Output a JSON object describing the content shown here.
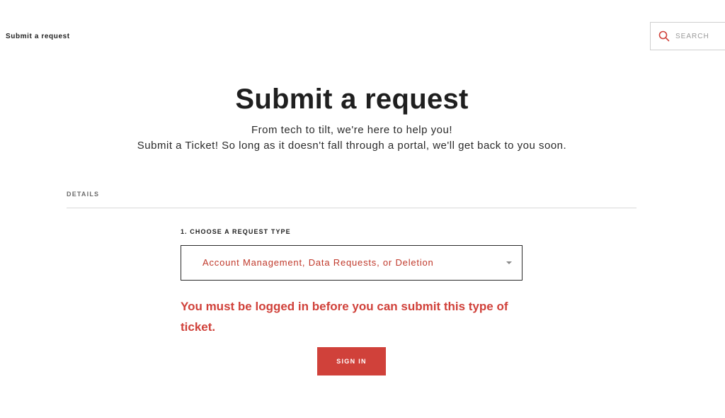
{
  "header": {
    "breadcrumb": "Submit a request",
    "search": {
      "placeholder": "SEARCH",
      "icon": "search-icon",
      "icon_color": "#d0413a"
    }
  },
  "main": {
    "title": "Submit a request",
    "subtitle_line1": "From tech to tilt, we're here to help you!",
    "subtitle_line2": "Submit a Ticket! So long as it doesn't fall through a portal, we'll get back to you soon."
  },
  "form": {
    "section_heading": "DETAILS",
    "request_type": {
      "label": "1. CHOOSE A REQUEST TYPE",
      "selected_value": "Account Management, Data Requests, or Deletion",
      "icon": "chevron-down-icon"
    },
    "error_message": "You must be logged in before you can submit this type of ticket.",
    "sign_in_label": "SIGN IN"
  },
  "colors": {
    "accent": "#d0413a",
    "text": "#1f1f1f",
    "muted": "#6b6b6b",
    "border": "#cfcfcf"
  }
}
